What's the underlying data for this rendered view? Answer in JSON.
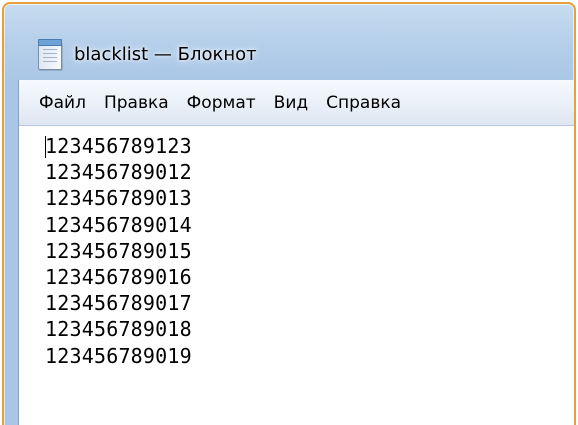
{
  "window": {
    "title": "blacklist — Блокнот",
    "icon": "notepad-icon"
  },
  "menu": {
    "items": [
      {
        "label": "Файл"
      },
      {
        "label": "Правка"
      },
      {
        "label": "Формат"
      },
      {
        "label": "Вид"
      },
      {
        "label": "Справка"
      }
    ]
  },
  "editor": {
    "lines": [
      "123456789123",
      "123456789012",
      "123456789013",
      "123456789014",
      "123456789015",
      "123456789016",
      "123456789017",
      "123456789018",
      "123456789019"
    ]
  },
  "colors": {
    "frame_border": "#e8a03a",
    "frame_glass": "#b5cfea",
    "menu_bg": "#eaf0f8",
    "editor_bg": "#ffffff",
    "text": "#000000"
  }
}
